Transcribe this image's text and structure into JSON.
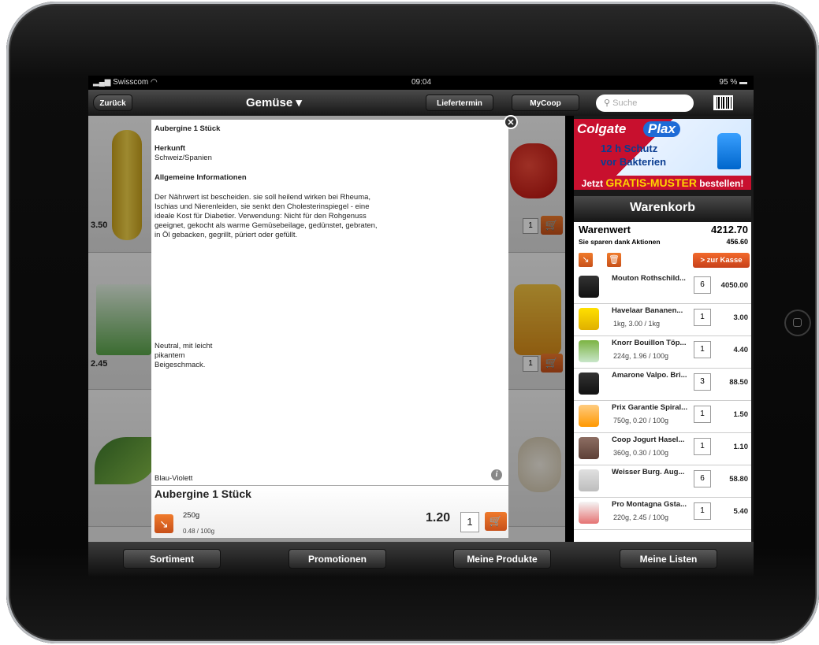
{
  "status": {
    "carrier": "Swisscom",
    "time": "09:04",
    "battery": "95 %"
  },
  "nav": {
    "back": "Zurück",
    "title": "Gemüse",
    "liefertermin": "Liefertermin",
    "mycoop": "MyCoop",
    "search_placeholder": "Suche"
  },
  "products": {
    "prices": [
      "3.50",
      "2.45"
    ],
    "qty": [
      "1",
      "1"
    ]
  },
  "popup": {
    "title": "Aubergine 1 Stück",
    "herkunft_label": "Herkunft",
    "herkunft_value": "Schweiz/Spanien",
    "allg_label": "Allgemeine Informationen",
    "allg_text": "Der Nährwert ist bescheiden. sie soll heilend wirken bei Rheuma, Ischias und Nierenleiden, sie senkt den Cholesterinspiegel - eine ideale Kost für Diabetier. Verwendung: Nicht für den Rohgenuss geeignet, gekocht als warme Gemüsebeilage, gedünstet, gebraten, in Öl gebacken, gegrillt, püriert oder gefüllt.",
    "taste": "Neutral, mit leicht pikantem Beigeschmack.",
    "color": "Blau-Violett",
    "footer_title": "Aubergine 1 Stück",
    "weight": "250g",
    "unit_price": "0.48 / 100g",
    "price": "1.20",
    "qty": "1"
  },
  "ad": {
    "brand": "Colgate",
    "product": "Plax",
    "line1": "12 h Schutz",
    "line2": "vor Bakterien",
    "banner_pre": "Jetzt ",
    "banner_gratis": "GRATIS-MUSTER",
    "banner_post": " bestellen!"
  },
  "cart": {
    "header": "Warenkorb",
    "warenwert_label": "Warenwert",
    "warenwert": "4212.70",
    "sparen_label": "Sie sparen dank Aktionen",
    "sparen": "456.60",
    "checkout": "> zur Kasse",
    "items": [
      {
        "name": "Mouton Rothschild...",
        "sub": "",
        "qty": "6",
        "price": "4050.00"
      },
      {
        "name": "Havelaar Bananen...",
        "sub": "1kg, 3.00 / 1kg",
        "qty": "1",
        "price": "3.00"
      },
      {
        "name": "Knorr Bouillon Töp...",
        "sub": "224g, 1.96 / 100g",
        "qty": "1",
        "price": "4.40"
      },
      {
        "name": "Amarone Valpo. Bri...",
        "sub": "",
        "qty": "3",
        "price": "88.50"
      },
      {
        "name": "Prix Garantie Spiral...",
        "sub": "750g, 0.20 / 100g",
        "qty": "1",
        "price": "1.50"
      },
      {
        "name": "Coop Jogurt Hasel...",
        "sub": "360g, 0.30 / 100g",
        "qty": "1",
        "price": "1.10"
      },
      {
        "name": "Weisser Burg. Aug...",
        "sub": "",
        "qty": "6",
        "price": "58.80"
      },
      {
        "name": "Pro Montagna Gsta...",
        "sub": "220g, 2.45 / 100g",
        "qty": "1",
        "price": "5.40"
      }
    ]
  },
  "tabs": {
    "sortiment": "Sortiment",
    "promotionen": "Promotionen",
    "meine_produkte": "Meine Produkte",
    "meine_listen": "Meine Listen"
  }
}
